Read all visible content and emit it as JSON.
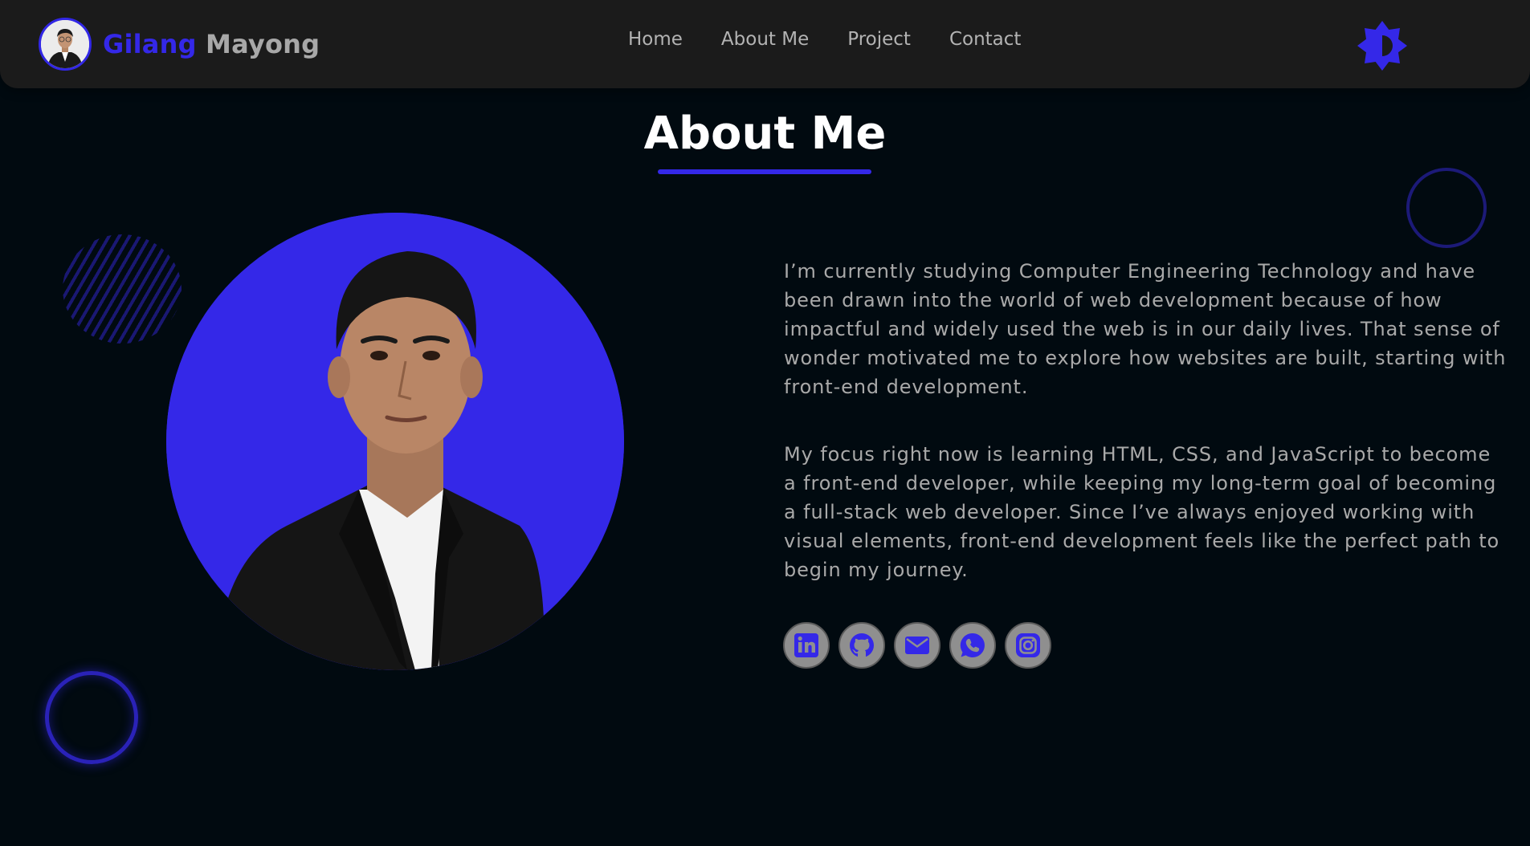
{
  "header": {
    "brand_first": "Gilang",
    "brand_last": "Mayong",
    "nav": [
      "Home",
      "About Me",
      "Project",
      "Contact"
    ],
    "theme_toggle_icon": "sun-icon"
  },
  "about": {
    "title": "About Me",
    "paragraphs": [
      "I’m currently studying Computer Engineering Technology and have been drawn into the world of web development because of how impactful and widely used the web is in our daily lives. That sense of wonder motivated me to explore how websites are built, starting with front-end development.",
      "My focus right now is learning HTML, CSS, and JavaScript to become a front-end developer, while keeping my long-term goal of becoming a full-stack web developer. Since I’ve always enjoyed working with visual elements, front-end development feels like the perfect path to begin my journey."
    ],
    "socials": [
      "linkedin-icon",
      "github-icon",
      "mail-icon",
      "whatsapp-icon",
      "instagram-icon"
    ]
  },
  "colors": {
    "accent": "#3428e8",
    "background": "#010a10",
    "navbar": "#1b1b1b",
    "text": "#a9a9a9"
  }
}
